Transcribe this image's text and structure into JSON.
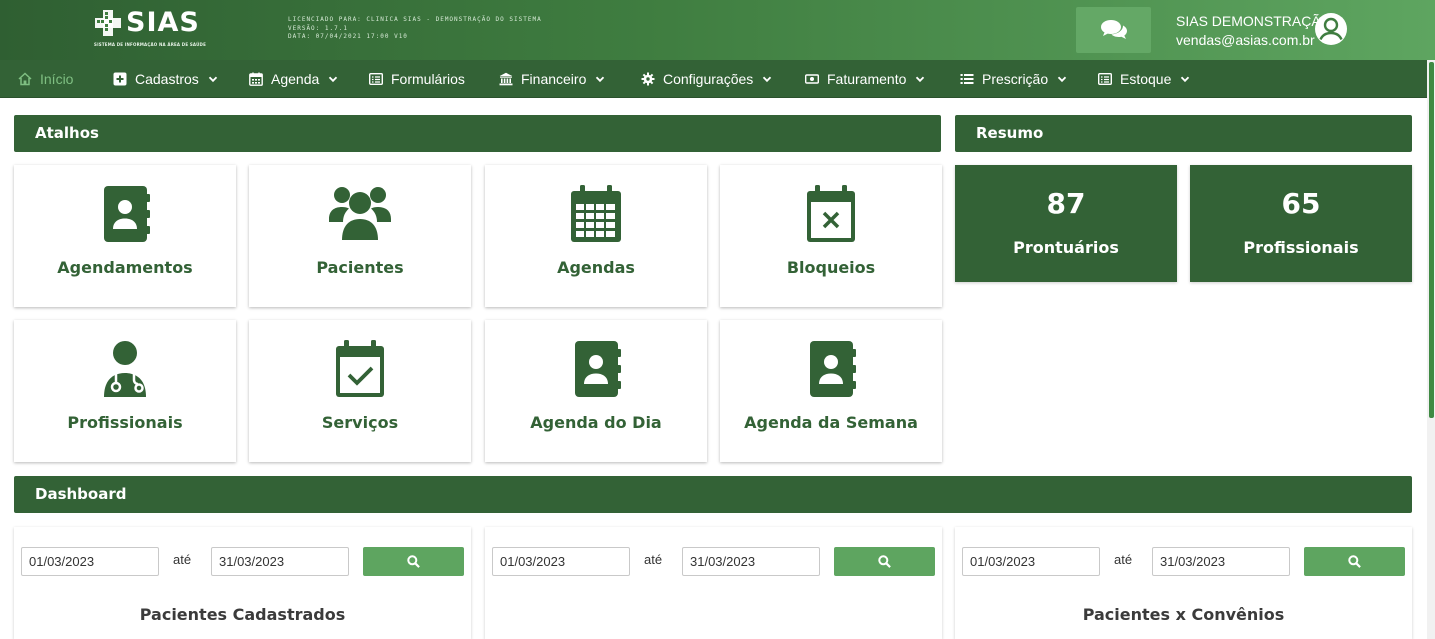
{
  "header": {
    "logo_text": "SIAS",
    "logo_tagline": "SISTEMA DE INFORMAÇÃO NA ÁREA DE SAÚDE",
    "license_line1": "LICENCIADO PARA: CLINICA SIAS - DEMONSTRAÇÃO DO SISTEMA",
    "license_line2": "VERSÃO: 1.7.1",
    "license_line3": "DATA: 07/04/2021 17:00 V10",
    "user_name": "SIAS DEMONSTRAÇÃO",
    "user_email": "vendas@asias.com.br",
    "chat_icon": "comments-icon",
    "avatar_icon": "user-circle-icon"
  },
  "nav": {
    "items": [
      {
        "label": "Início",
        "icon": "home-icon",
        "dropdown": false,
        "active": true
      },
      {
        "label": "Cadastros",
        "icon": "plus-square-icon",
        "dropdown": true
      },
      {
        "label": "Agenda",
        "icon": "calendar-icon",
        "dropdown": true
      },
      {
        "label": "Formulários",
        "icon": "list-alt-icon",
        "dropdown": false
      },
      {
        "label": "Financeiro",
        "icon": "bank-icon",
        "dropdown": true
      },
      {
        "label": "Configurações",
        "icon": "cog-icon",
        "dropdown": true
      },
      {
        "label": "Faturamento",
        "icon": "money-bill-icon",
        "dropdown": true
      },
      {
        "label": "Prescrição",
        "icon": "list-icon",
        "dropdown": true
      },
      {
        "label": "Estoque",
        "icon": "list-alt-icon",
        "dropdown": true
      }
    ]
  },
  "atalhos": {
    "title": "Atalhos",
    "tiles": [
      {
        "label": "Agendamentos",
        "icon": "address-book-icon"
      },
      {
        "label": "Pacientes",
        "icon": "users-icon"
      },
      {
        "label": "Agendas",
        "icon": "calendar-grid-icon"
      },
      {
        "label": "Bloqueios",
        "icon": "calendar-times-icon"
      },
      {
        "label": "Profissionais",
        "icon": "user-doctor-icon"
      },
      {
        "label": "Serviços",
        "icon": "calendar-check-icon"
      },
      {
        "label": "Agenda do Dia",
        "icon": "address-book-icon"
      },
      {
        "label": "Agenda da Semana",
        "icon": "address-book-icon"
      }
    ]
  },
  "resumo": {
    "title": "Resumo",
    "cards": [
      {
        "value": "87",
        "label": "Prontuários"
      },
      {
        "value": "65",
        "label": "Profissionais"
      }
    ]
  },
  "dashboard": {
    "title": "Dashboard",
    "panels": [
      {
        "start": "01/03/2023",
        "sep": "até",
        "end": "31/03/2023",
        "title": "Pacientes Cadastrados"
      },
      {
        "start": "01/03/2023",
        "sep": "até",
        "end": "31/03/2023",
        "title": ""
      },
      {
        "start": "01/03/2023",
        "sep": "até",
        "end": "31/03/2023",
        "title": "Pacientes x Convênios"
      }
    ]
  },
  "colors": {
    "primary": "#336236",
    "accent": "#5ea560",
    "active_nav": "#7fbf82"
  }
}
